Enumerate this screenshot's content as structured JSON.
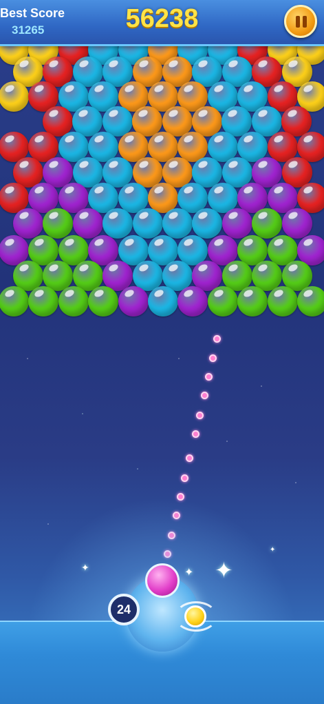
{
  "hud": {
    "best_score_label": "Best Score",
    "best_score_value": "31265",
    "current_score": "56238",
    "pause_icon": "pause-icon"
  },
  "colors": {
    "Y": "#ffd21a",
    "R": "#e82222",
    "C": "#1bb8e6",
    "O": "#ff9a1a",
    "P": "#a123d1",
    "G": "#55cf17"
  },
  "bubble_rows": [
    "YYRCCOCCRYY",
    "YRCCOOCCRY",
    "YRCCOOOCCRY",
    "RCCOOOCCR",
    "RRCCOOOCCRR",
    "RPCCOOCCPR",
    "RPPCCOCCPPR",
    "PGPCCCCPGP",
    "PGGPCCCPGGP",
    "GGGPCCPGGG",
    "GGGGPCPGGGG"
  ],
  "launcher": {
    "shots_remaining": "24",
    "current_bubble": "P",
    "next_bubble": "Y"
  }
}
